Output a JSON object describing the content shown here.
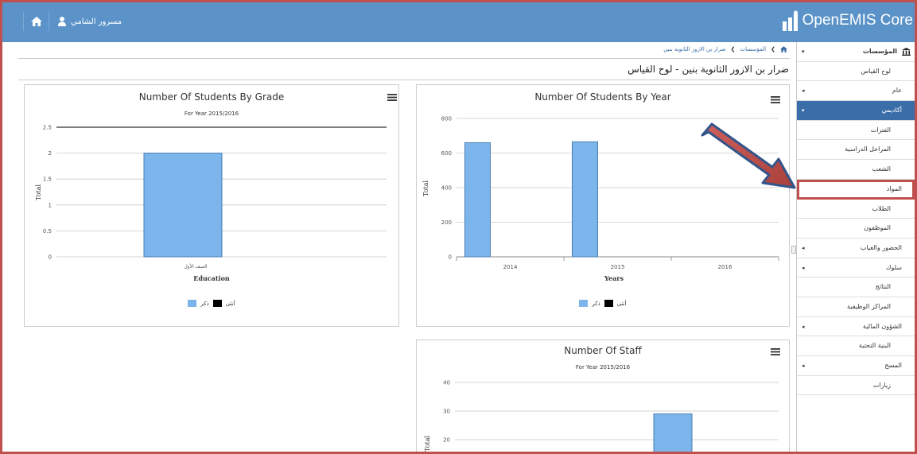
{
  "topbar": {
    "user_name": "مسرور الشامي",
    "brand": "OpenEMIS Core",
    "bg_color": "#5b93c9"
  },
  "sidebar": {
    "items": [
      {
        "label": "المؤسسات",
        "kind": "header",
        "caret": "▾"
      },
      {
        "label": "لوح القياس",
        "kind": "lang"
      },
      {
        "label": "عام",
        "kind": "item",
        "caret": "◂"
      },
      {
        "label": "أكاديمي",
        "kind": "active",
        "caret": "▾"
      },
      {
        "label": "الفترات",
        "kind": "sub"
      },
      {
        "label": "المراحل الدراسية",
        "kind": "sub"
      },
      {
        "label": "الشعب",
        "kind": "sub"
      },
      {
        "label": "المواد",
        "kind": "highlight"
      },
      {
        "label": "الطلاب",
        "kind": "sub"
      },
      {
        "label": "الموظفون",
        "kind": "sub"
      },
      {
        "label": "الحضور والغياب",
        "kind": "item",
        "caret": "◂"
      },
      {
        "label": "سلوك",
        "kind": "item",
        "caret": "◂"
      },
      {
        "label": "النتائج",
        "kind": "sub"
      },
      {
        "label": "المراكز الوظيفية",
        "kind": "sub"
      },
      {
        "label": "الشؤون المالية",
        "kind": "item",
        "caret": "◂"
      },
      {
        "label": "البنية التحتية",
        "kind": "sub"
      },
      {
        "label": "المسح",
        "kind": "item",
        "caret": "◂"
      },
      {
        "label": "زيارات",
        "kind": "sub"
      }
    ],
    "active_color": "#3b6ea8",
    "highlight_color": "#c0504d"
  },
  "breadcrumb": {
    "items": [
      "المؤسسات",
      "ضرار بن الازور الثانوية بنين"
    ]
  },
  "page_title": "ضرار بن الازور الثانوية بنين - لوح القياس",
  "charts": {
    "grade_title": "Number Of Students By Grade",
    "grade_subtitle": "For Year 2015/2016",
    "year_title": "Number Of Students By Year",
    "staff_title": "Number Of Staff",
    "staff_subtitle": "For Year 2015/2016",
    "legend_female": "أنثى",
    "legend_male": "ذكر"
  },
  "chart_data": [
    {
      "type": "bar",
      "title": "Number Of Students By Grade",
      "subtitle": "For Year 2015/2016",
      "xlabel": "Education",
      "ylabel": "Total",
      "ylim": [
        0,
        2.5
      ],
      "yticks": [
        "0",
        "0.5",
        "1",
        "1.5",
        "2",
        "2.5"
      ],
      "categories": [
        "الصف الأول"
      ],
      "series": [
        {
          "name": "أنثى",
          "color": "#7cb5ec",
          "values": [
            2
          ]
        },
        {
          "name": "ذكر",
          "color": "#000000",
          "values": [
            0
          ]
        }
      ],
      "legend": "bottom-center"
    },
    {
      "type": "bar",
      "title": "Number Of Students By Year",
      "xlabel": "Years",
      "ylabel": "Total",
      "ylim": [
        0,
        800
      ],
      "yticks": [
        "0",
        "200",
        "400",
        "600",
        "800"
      ],
      "categories": [
        "2014",
        "2015",
        "2016"
      ],
      "series": [
        {
          "name": "أنثى",
          "color": "#7cb5ec",
          "values": [
            660,
            665,
            0
          ]
        },
        {
          "name": "ذكر",
          "color": "#000000",
          "values": [
            0,
            0,
            0
          ]
        }
      ],
      "legend": "bottom-center"
    },
    {
      "type": "bar",
      "title": "Number Of Staff",
      "subtitle": "For Year 2015/2016",
      "ylabel": "Total",
      "ylim": [
        20,
        40
      ],
      "yticks": [
        "20",
        "30",
        "40"
      ],
      "series": [
        {
          "name": "",
          "color": "#7cb5ec",
          "values": [
            29
          ]
        }
      ]
    }
  ]
}
